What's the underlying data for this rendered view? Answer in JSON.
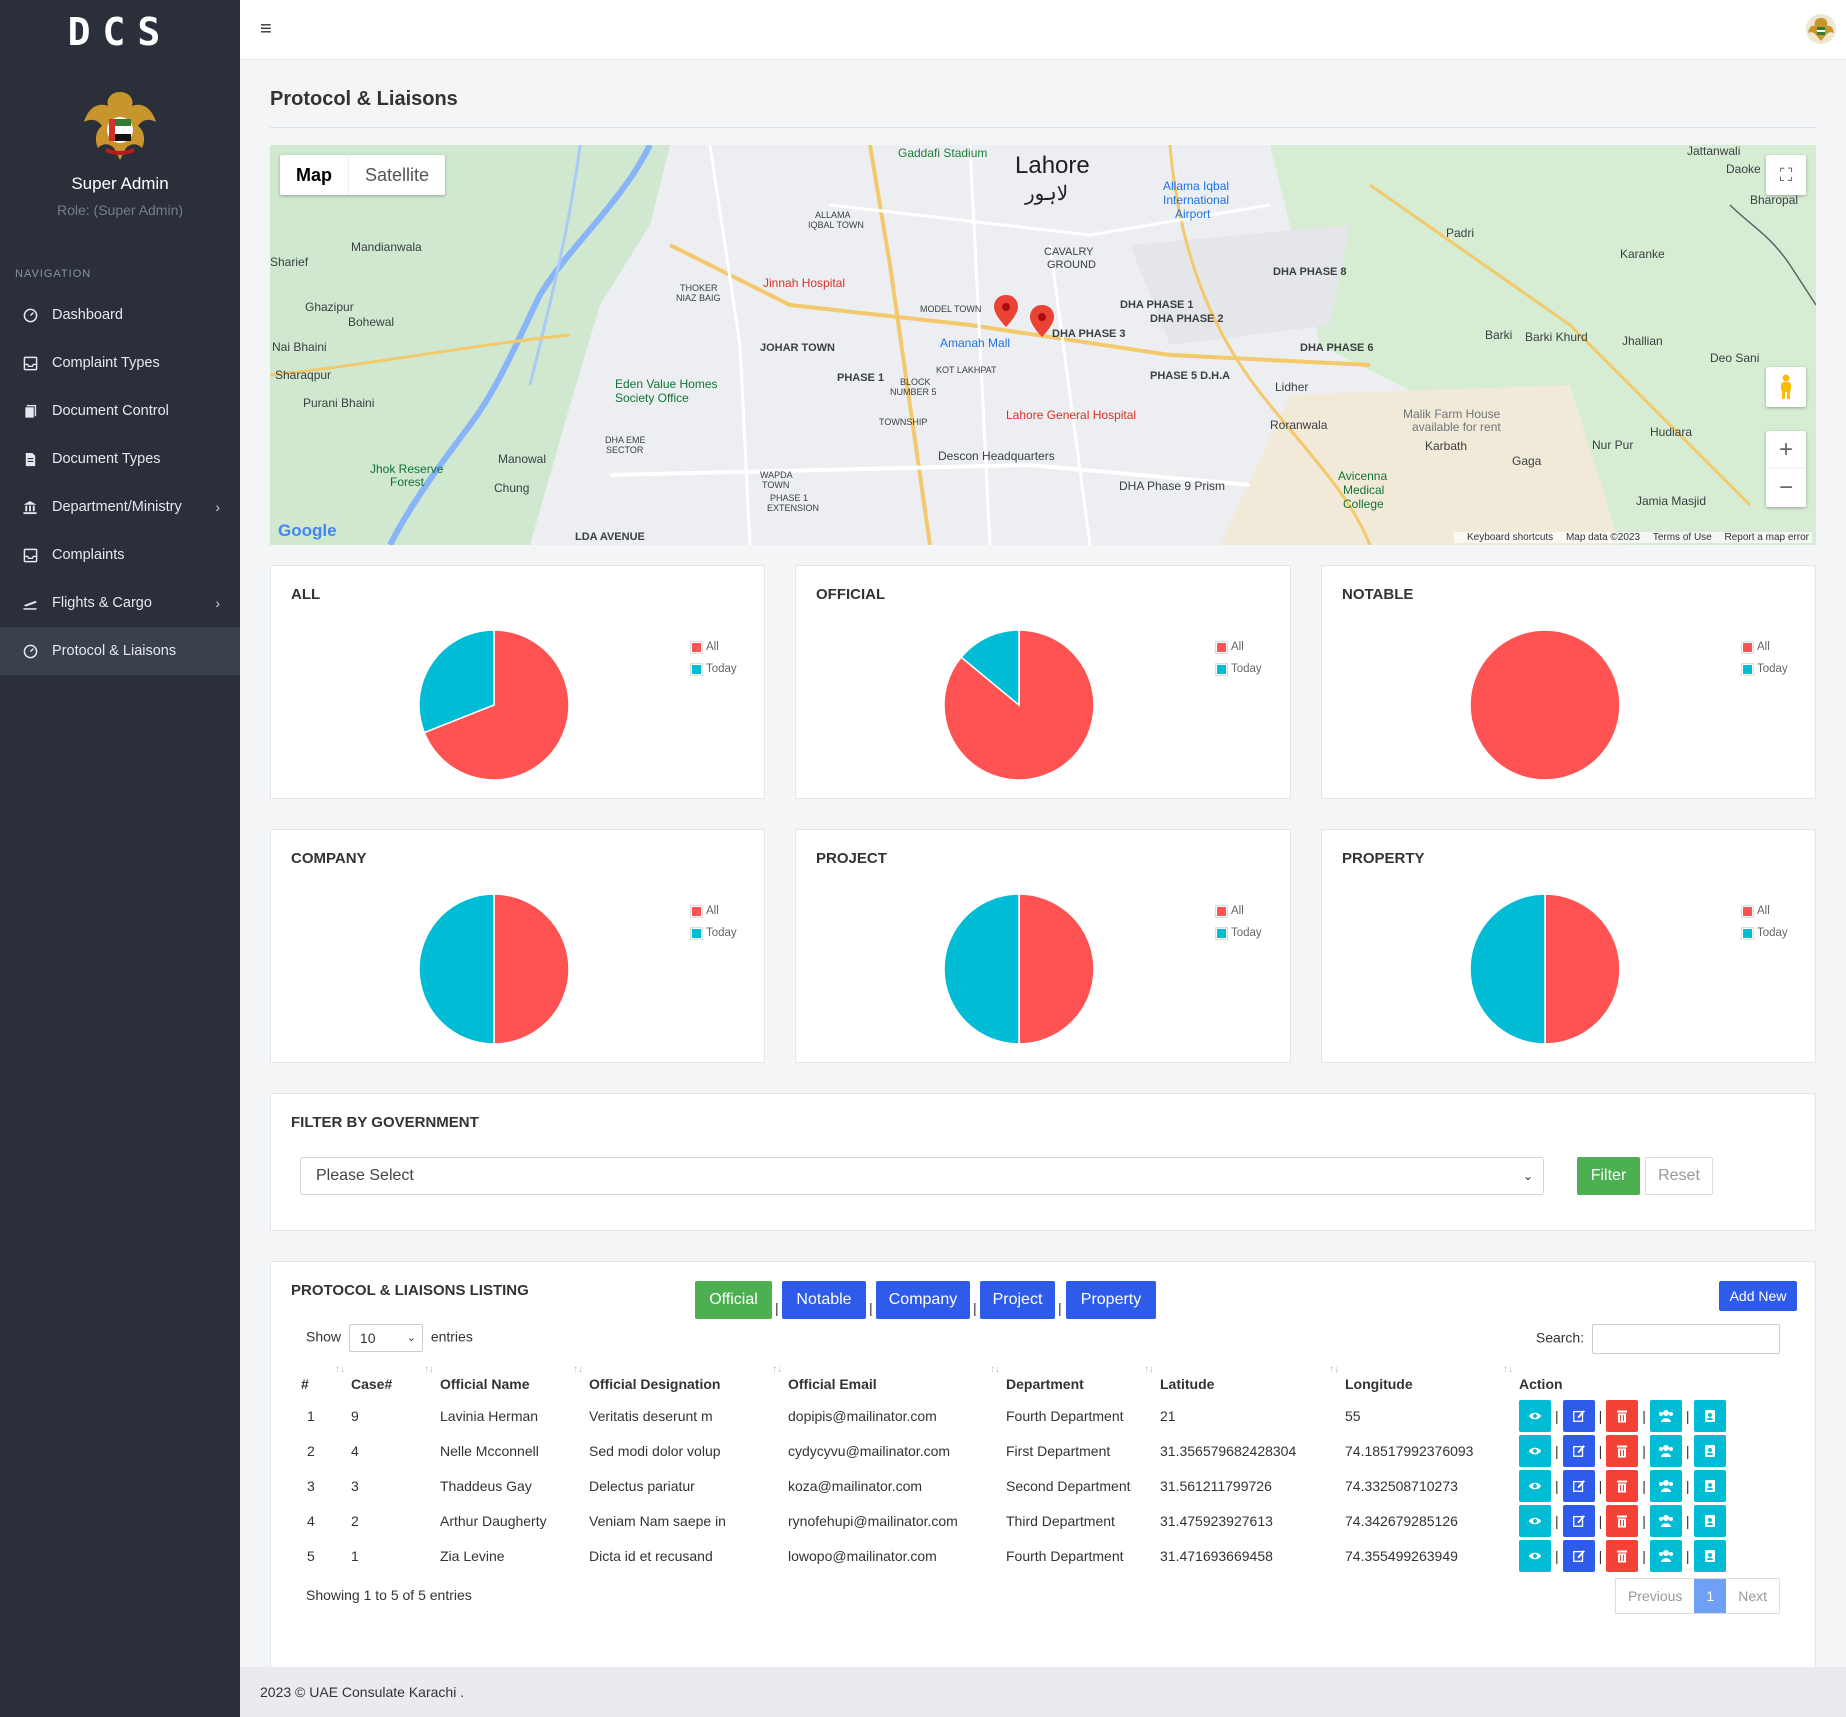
{
  "brand": {
    "logo_text": "DCS"
  },
  "user": {
    "name": "Super Admin",
    "role": "Role: (Super Admin)"
  },
  "nav": {
    "heading": "NAVIGATION",
    "items": [
      {
        "label": "Dashboard",
        "icon": "dashboard-icon"
      },
      {
        "label": "Complaint Types",
        "icon": "inbox-icon"
      },
      {
        "label": "Document Control",
        "icon": "documents-icon"
      },
      {
        "label": "Document Types",
        "icon": "file-icon"
      },
      {
        "label": "Department/Ministry",
        "icon": "bank-icon",
        "has_children": true
      },
      {
        "label": "Complaints",
        "icon": "inbox-icon"
      },
      {
        "label": "Flights & Cargo",
        "icon": "plane-icon",
        "has_children": true
      },
      {
        "label": "Protocol & Liaisons",
        "icon": "dashboard-icon",
        "active": true
      }
    ]
  },
  "page": {
    "title": "Protocol & Liaisons"
  },
  "map": {
    "toggle": [
      "Map",
      "Satellite"
    ],
    "labels": [
      "Lahore",
      "لاہور",
      "Gaddafi Stadium",
      "Allama Iqbal International Airport",
      "Jinnah Hospital",
      "Amanah Mall",
      "DHA PHASE 3",
      "DHA PHASE 1",
      "DHA PHASE 2",
      "DHA PHASE 5 D.H.A",
      "DHA PHASE 6",
      "DHA PHASE 8",
      "JOHAR TOWN",
      "MODEL TOWN",
      "PHASE 1",
      "KOT LAKHPAT",
      "TOWNSHIP",
      "Lahore General Hospital",
      "Descon Headquarters",
      "DHA Phase 9 Prism",
      "Eden Value Homes Society Office",
      "Jhok Reserve Forest",
      "Manowal",
      "Chung",
      "WAPDA TOWN",
      "LDA AVENUE",
      "Mandianwala",
      "Ghazipur",
      "Bohewal",
      "Nai Bhaini",
      "Sharaqpur",
      "Purani Bhaini",
      "Sharief",
      "Lidher",
      "Roranwala",
      "Malik Farm House available for rent",
      "Karbath",
      "Gaga",
      "Avicenna Medical College",
      "Barki",
      "Barki Khurd",
      "Jhallian",
      "Deo Sani",
      "Hudiara",
      "Nur Pur",
      "Karanke",
      "Padri",
      "Jattanwali",
      "Daoke",
      "Bharopal",
      "Jamia Masjid",
      "DHA EME SECTOR",
      "BLOCK NUMBER 5",
      "THOKER NIAZ BAIG",
      "ALLAMA IQBAL TOWN",
      "CAVALRY GROUND",
      "PHASE 1 EXTENSION"
    ],
    "google": "Google",
    "footer": [
      "Keyboard shortcuts",
      "Map data ©2023",
      "Terms of Use",
      "Report a map error"
    ]
  },
  "charts": [
    {
      "title": "ALL",
      "legend": [
        "All",
        "Today"
      ]
    },
    {
      "title": "OFFICIAL",
      "legend": [
        "All",
        "Today"
      ]
    },
    {
      "title": "NOTABLE",
      "legend": [
        "All",
        "Today"
      ]
    },
    {
      "title": "COMPANY",
      "legend": [
        "All",
        "Today"
      ]
    },
    {
      "title": "PROJECT",
      "legend": [
        "All",
        "Today"
      ]
    },
    {
      "title": "PROPERTY",
      "legend": [
        "All",
        "Today"
      ]
    }
  ],
  "chart_data": [
    {
      "type": "pie",
      "title": "ALL",
      "labels": [
        "All",
        "Today"
      ],
      "values": [
        69,
        31
      ],
      "colors": [
        "#ff5252",
        "#00bcd4"
      ]
    },
    {
      "type": "pie",
      "title": "OFFICIAL",
      "labels": [
        "All",
        "Today"
      ],
      "values": [
        86,
        14
      ],
      "colors": [
        "#ff5252",
        "#00bcd4"
      ]
    },
    {
      "type": "pie",
      "title": "NOTABLE",
      "labels": [
        "All",
        "Today"
      ],
      "values": [
        100,
        0
      ],
      "colors": [
        "#ff5252",
        "#00bcd4"
      ]
    },
    {
      "type": "pie",
      "title": "COMPANY",
      "labels": [
        "All",
        "Today"
      ],
      "values": [
        50,
        50
      ],
      "colors": [
        "#ff5252",
        "#00bcd4"
      ]
    },
    {
      "type": "pie",
      "title": "PROJECT",
      "labels": [
        "All",
        "Today"
      ],
      "values": [
        50,
        50
      ],
      "colors": [
        "#ff5252",
        "#00bcd4"
      ]
    },
    {
      "type": "pie",
      "title": "PROPERTY",
      "labels": [
        "All",
        "Today"
      ],
      "values": [
        50,
        50
      ],
      "colors": [
        "#ff5252",
        "#00bcd4"
      ]
    }
  ],
  "filter": {
    "title": "FILTER BY GOVERNMENT",
    "placeholder": "Please Select",
    "filter_label": "Filter",
    "reset_label": "Reset"
  },
  "listing": {
    "title": "PROTOCOL & LIAISONS LISTING",
    "tabs": [
      "Official",
      "Notable",
      "Company",
      "Project",
      "Property"
    ],
    "add_new": "Add New",
    "show": "Show",
    "entries_value": "10",
    "entries": "entries",
    "search_label": "Search:",
    "columns": [
      "#",
      "Case#",
      "Official Name",
      "Official Designation",
      "Official Email",
      "Department",
      "Latitude",
      "Longitude",
      "Action"
    ],
    "rows": [
      [
        "1",
        "9",
        "Lavinia Herman",
        "Veritatis deserunt m",
        "dopipis@mailinator.com",
        "Fourth Department",
        "21",
        "55"
      ],
      [
        "2",
        "4",
        "Nelle Mcconnell",
        "Sed modi dolor volup",
        "cydycyvu@mailinator.com",
        "First Department",
        "31.356579682428304",
        "74.18517992376093"
      ],
      [
        "3",
        "3",
        "Thaddeus Gay",
        "Delectus pariatur",
        "koza@mailinator.com",
        "Second Department",
        "31.561211799726",
        "74.332508710273"
      ],
      [
        "4",
        "2",
        "Arthur Daugherty",
        "Veniam Nam saepe in",
        "rynofehupi@mailinator.com",
        "Third Department",
        "31.475923927613",
        "74.342679285126"
      ],
      [
        "5",
        "1",
        "Zia Levine",
        "Dicta id et recusand",
        "lowopo@mailinator.com",
        "Fourth Department",
        "31.471693669458",
        "74.355499263949"
      ]
    ],
    "info": "Showing 1 to 5 of 5 entries",
    "pager": {
      "prev": "Previous",
      "current": "1",
      "next": "Next"
    }
  },
  "footer": {
    "text": "2023 © UAE Consulate Karachi ."
  },
  "colors": {
    "sidebar": "#2a2f3a",
    "red": "#ff5252",
    "cyan": "#00bcd4",
    "green": "#4caf50",
    "blue": "#2f5bea"
  }
}
